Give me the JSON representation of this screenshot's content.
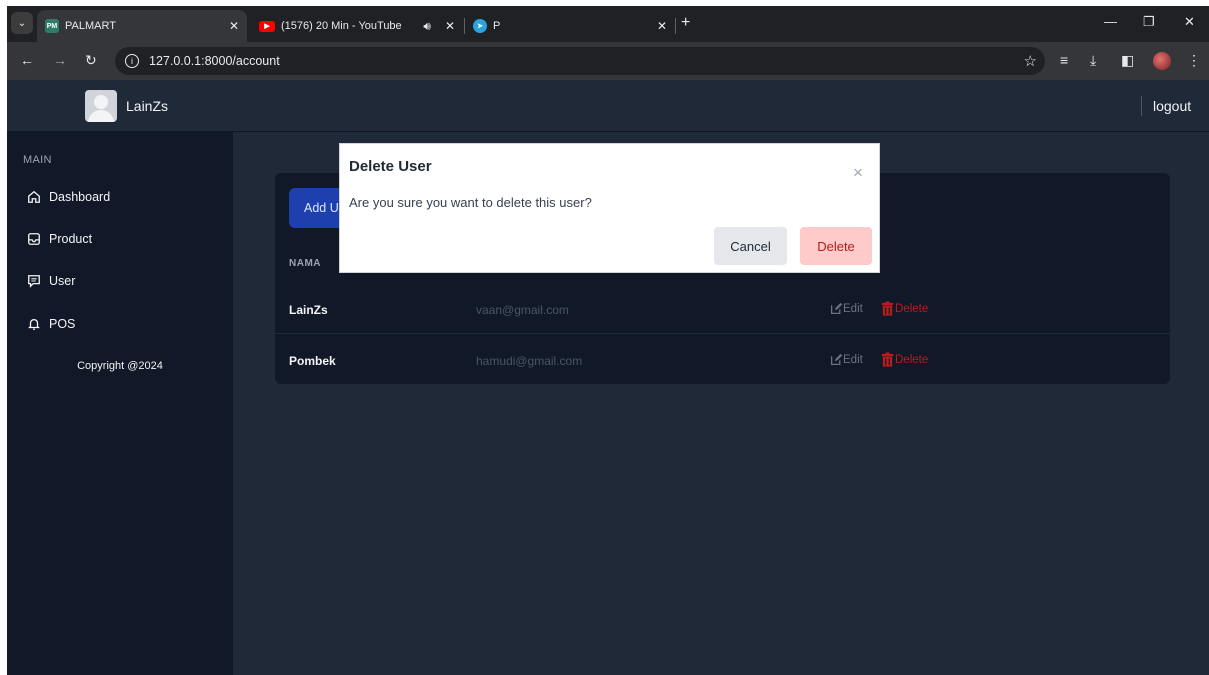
{
  "browser": {
    "tabs": [
      {
        "favicon": "PM",
        "title": "PALMART",
        "active": true
      },
      {
        "favicon": "youtube-icon",
        "title": "(1576) 20 Min - YouTube",
        "active": false
      },
      {
        "favicon": "telegram-icon",
        "title": "P",
        "active": false
      }
    ],
    "url": "127.0.0.1:8000/account"
  },
  "header": {
    "username": "LainZs",
    "logout_label": "logout"
  },
  "sidebar": {
    "section_label": "MAIN",
    "items": [
      {
        "label": "Dashboard",
        "icon": "home-icon"
      },
      {
        "label": "Product",
        "icon": "inbox-icon"
      },
      {
        "label": "User",
        "icon": "message-icon"
      },
      {
        "label": "POS",
        "icon": "bell-icon"
      }
    ],
    "copyright": "Copyright @2024"
  },
  "main": {
    "add_button_label": "Add U",
    "column_header": "NAMA",
    "rows": [
      {
        "name": "LainZs",
        "email": "vaan@gmail.com",
        "edit_label": "Edit",
        "delete_label": "Delete"
      },
      {
        "name": "Pombek",
        "email": "hamudi@gmail.com",
        "edit_label": "Edit",
        "delete_label": "Delete"
      }
    ]
  },
  "modal": {
    "title": "Delete User",
    "close_glyph": "×",
    "message": "Are you sure you want to delete this user?",
    "cancel_label": "Cancel",
    "delete_label": "Delete"
  },
  "colors": {
    "app_bg": "#1f2937",
    "sidebar_bg": "#111827",
    "primary": "#1e40af",
    "danger": "#b91c1c",
    "danger_soft": "#fecaca"
  }
}
